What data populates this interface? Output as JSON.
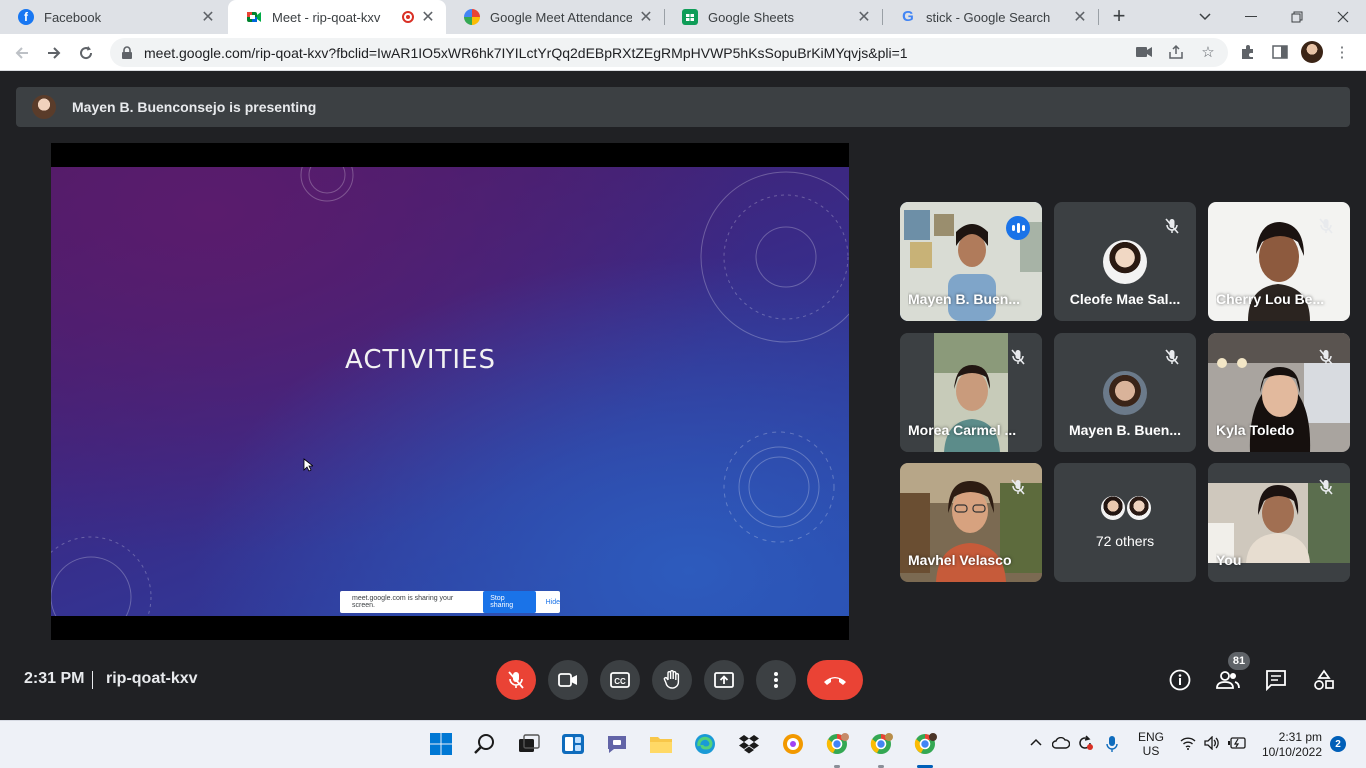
{
  "browser": {
    "tabs": [
      {
        "title": "Facebook",
        "icon": "facebook-icon"
      },
      {
        "title": "Meet - rip-qoat-kxv",
        "icon": "google-meet-icon",
        "active": true,
        "recording": true
      },
      {
        "title": "Google Meet Attendance - C",
        "icon": "attendance-extension-icon"
      },
      {
        "title": "Google Sheets",
        "icon": "google-sheets-icon"
      },
      {
        "title": "stick - Google Search",
        "icon": "google-icon"
      }
    ],
    "url": "meet.google.com/rip-qoat-kxv?fbclid=IwAR1IO5xWR6hk7IYILctYrQq2dEBpRXtZEgRMpHVWP5hKsSopuBrKiMYqvjs&pli=1"
  },
  "meet": {
    "presenting_banner": "Mayen B. Buenconsejo is presenting",
    "slide": {
      "title": "ACTIVITIES",
      "share_notice": "meet.google.com is sharing your screen.",
      "stop_sharing": "Stop sharing",
      "hide": "Hide"
    },
    "participants": [
      {
        "name": "Mayen B. Buen...",
        "speaking": true
      },
      {
        "name": "Cleofe Mae Sal...",
        "muted": true,
        "avatar": true
      },
      {
        "name": "Cherry Lou Be...",
        "muted": true
      },
      {
        "name": "Morea Carmel ...",
        "muted": true
      },
      {
        "name": "Mayen B. Buen...",
        "muted": true,
        "avatar": true
      },
      {
        "name": "Kyla Toledo",
        "muted": true
      },
      {
        "name": "Mavhel Velasco",
        "muted": true
      },
      {
        "name": "72 others"
      },
      {
        "name": "You",
        "muted": true
      }
    ],
    "bottom": {
      "time": "2:31 PM",
      "meeting_code": "rip-qoat-kxv",
      "people_count": "81"
    }
  },
  "taskbar": {
    "lang_line1": "ENG",
    "lang_line2": "US",
    "time": "2:31 pm",
    "date": "10/10/2022",
    "notifications": "2"
  },
  "colors": {
    "meet_bg": "#202124",
    "tile_bg": "#3c4043",
    "end_call_red": "#ea4335",
    "accent_blue": "#1a73e8"
  }
}
